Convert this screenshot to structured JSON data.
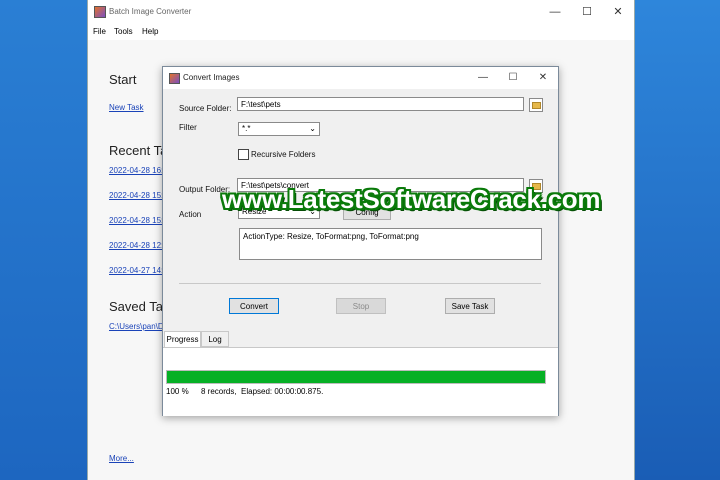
{
  "app": {
    "title": "Batch Image Converter",
    "window_controls": {
      "minimize": "—",
      "maximize": "☐",
      "close": "✕"
    }
  },
  "menu": [
    "File",
    "Tools",
    "Help"
  ],
  "start": {
    "title": "Start",
    "new_task": "New Task"
  },
  "recent": {
    "title": "Recent Tas",
    "items": [
      "2022-04-28 16:2",
      "2022-04-28 15:5",
      "2022-04-28 15:5",
      "2022-04-28 12:1",
      "2022-04-27 14:5"
    ]
  },
  "saved": {
    "title": "Saved Tas",
    "path": "C:\\Users\\pan\\D"
  },
  "more_link": "More...",
  "dialog": {
    "title": "Convert Images",
    "source_folder_label": "Source Folder:",
    "source_folder_value": "F:\\test\\pets",
    "filter_label": "Filter",
    "filter_value": "*.*",
    "recursive_label": "Recursive Folders",
    "output_folder_label": "Output Folder:",
    "output_folder_value": "F:\\test\\pets\\convert",
    "action_label": "Action",
    "action_select": "Resize",
    "config_button": "Config",
    "action_summary": "ActionType: Resize, ToFormat:png, ToFormat:png",
    "convert_button": "Convert",
    "stop_button": "Stop",
    "save_task_button": "Save Task",
    "tabs": [
      "Progress",
      "Log"
    ],
    "progress_percent": "100 %",
    "progress_value": 1.0,
    "records": "8 records,",
    "elapsed": "Elapsed: 00:00:00.875."
  },
  "watermark": "www.LatestSoftwareCrack.com",
  "colors": {
    "progress_fill": "#06b025",
    "link": "#1a43b8",
    "desktop": "#1f6fc1",
    "primary_button_border": "#0078d7"
  }
}
